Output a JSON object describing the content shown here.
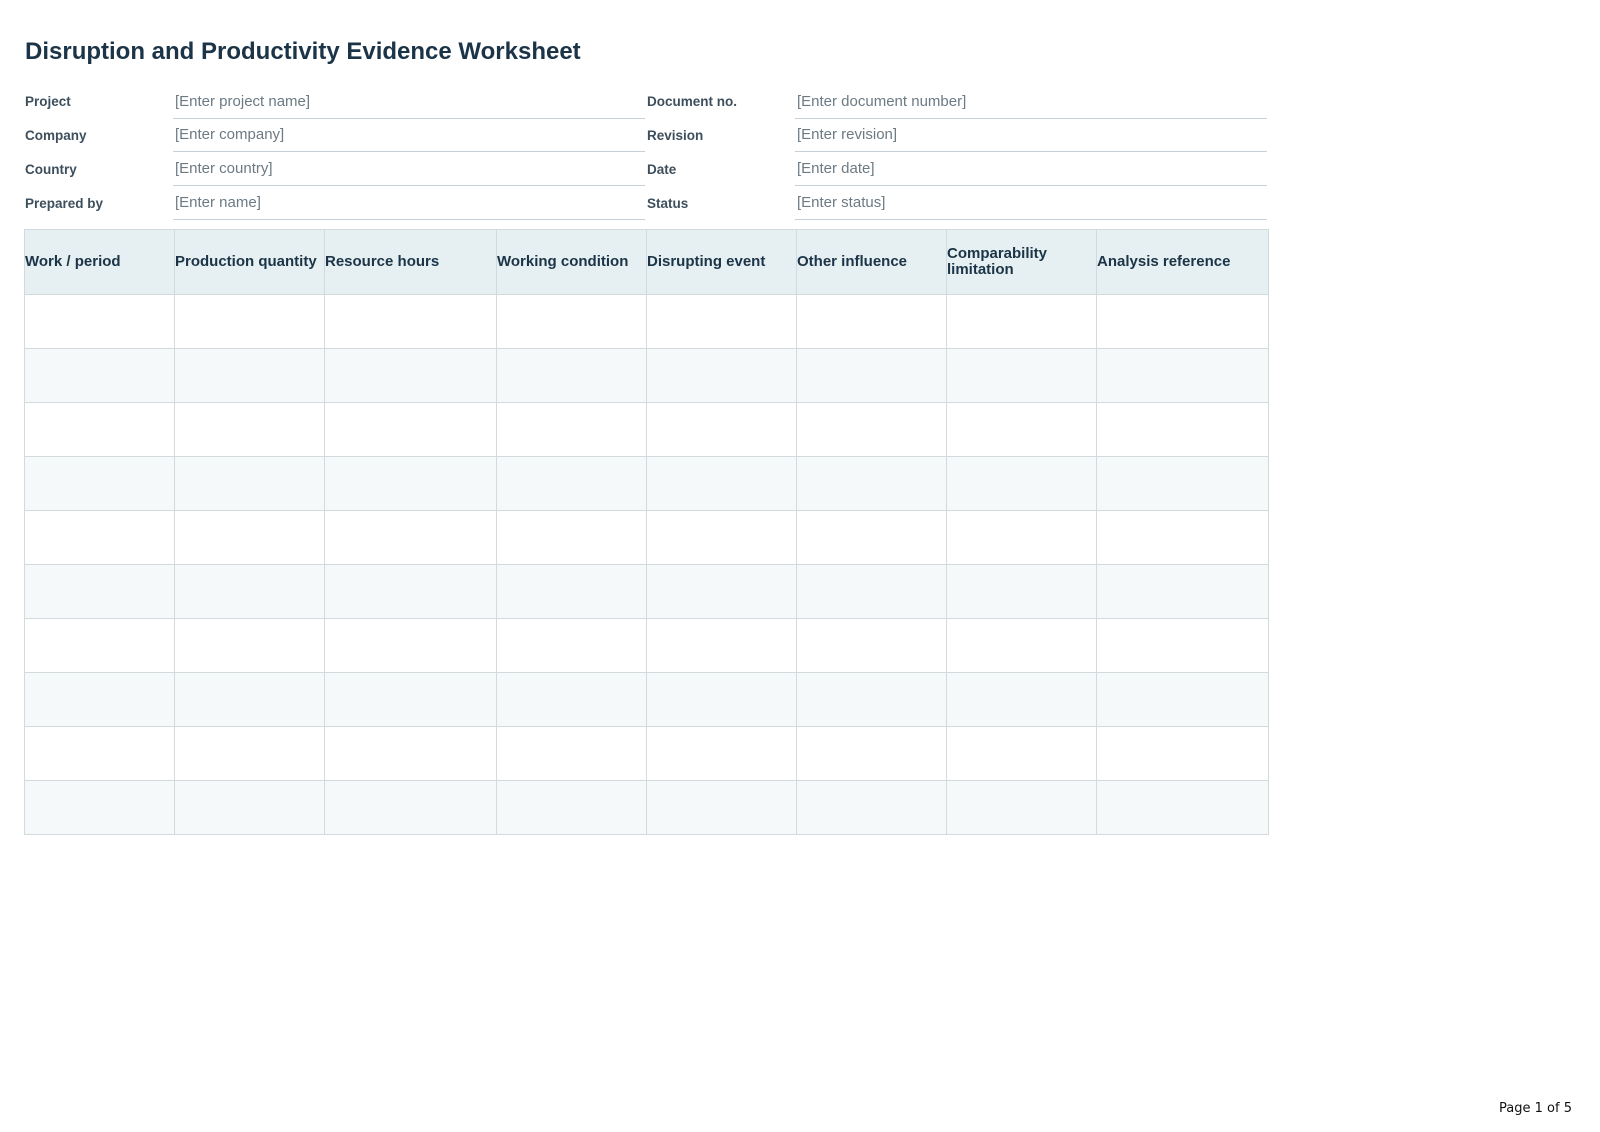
{
  "document": {
    "title": "Disruption and Productivity Evidence Worksheet",
    "page_indicator": "Page 1 of 5"
  },
  "meta_fields": {
    "left": [
      {
        "label": "Project",
        "placeholder": "[Enter project name]"
      },
      {
        "label": "Company",
        "placeholder": "[Enter company]"
      },
      {
        "label": "Country",
        "placeholder": "[Enter country]"
      },
      {
        "label": "Prepared by",
        "placeholder": "[Enter name]"
      }
    ],
    "right": [
      {
        "label": "Document no.",
        "placeholder": "[Enter document number]"
      },
      {
        "label": "Revision",
        "placeholder": "[Enter revision]"
      },
      {
        "label": "Date",
        "placeholder": "[Enter date]"
      },
      {
        "label": "Status",
        "placeholder": "[Enter status]"
      }
    ]
  },
  "table": {
    "columns": [
      "Work / period",
      "Production quantity",
      "Resource hours",
      "Working condition",
      "Disrupting event",
      "Other influence",
      "Comparability limitation",
      "Analysis reference"
    ],
    "empty_rows": 10
  },
  "colors": {
    "title": "#1b3447",
    "header_fill": "#e6f0f2",
    "alt_row_fill": "#f6f9fa",
    "grid_line": "#d3dadd"
  }
}
